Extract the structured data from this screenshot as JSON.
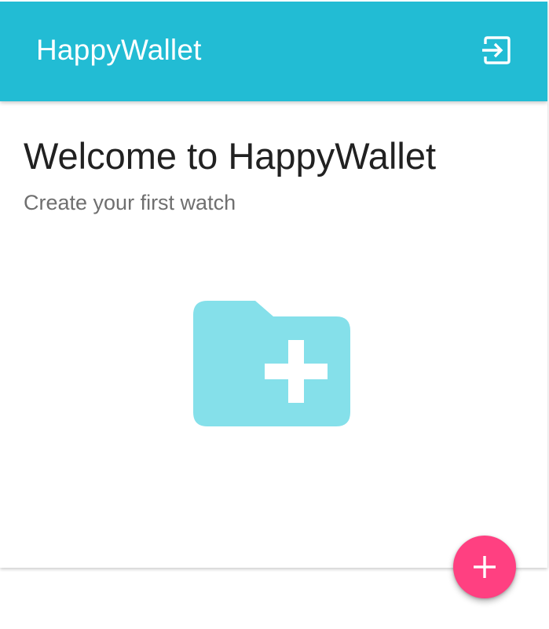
{
  "app_bar": {
    "title": "HappyWallet",
    "logout_icon": "exit-to-app-icon"
  },
  "main": {
    "title": "Welcome to HappyWallet",
    "subtitle": "Create your first watch",
    "illustration_icon": "create-new-folder-icon"
  },
  "fab": {
    "icon": "plus-icon"
  },
  "colors": {
    "primary": "#22BCD4",
    "illustration": "#85E0EA",
    "accent": "#FF4081"
  }
}
